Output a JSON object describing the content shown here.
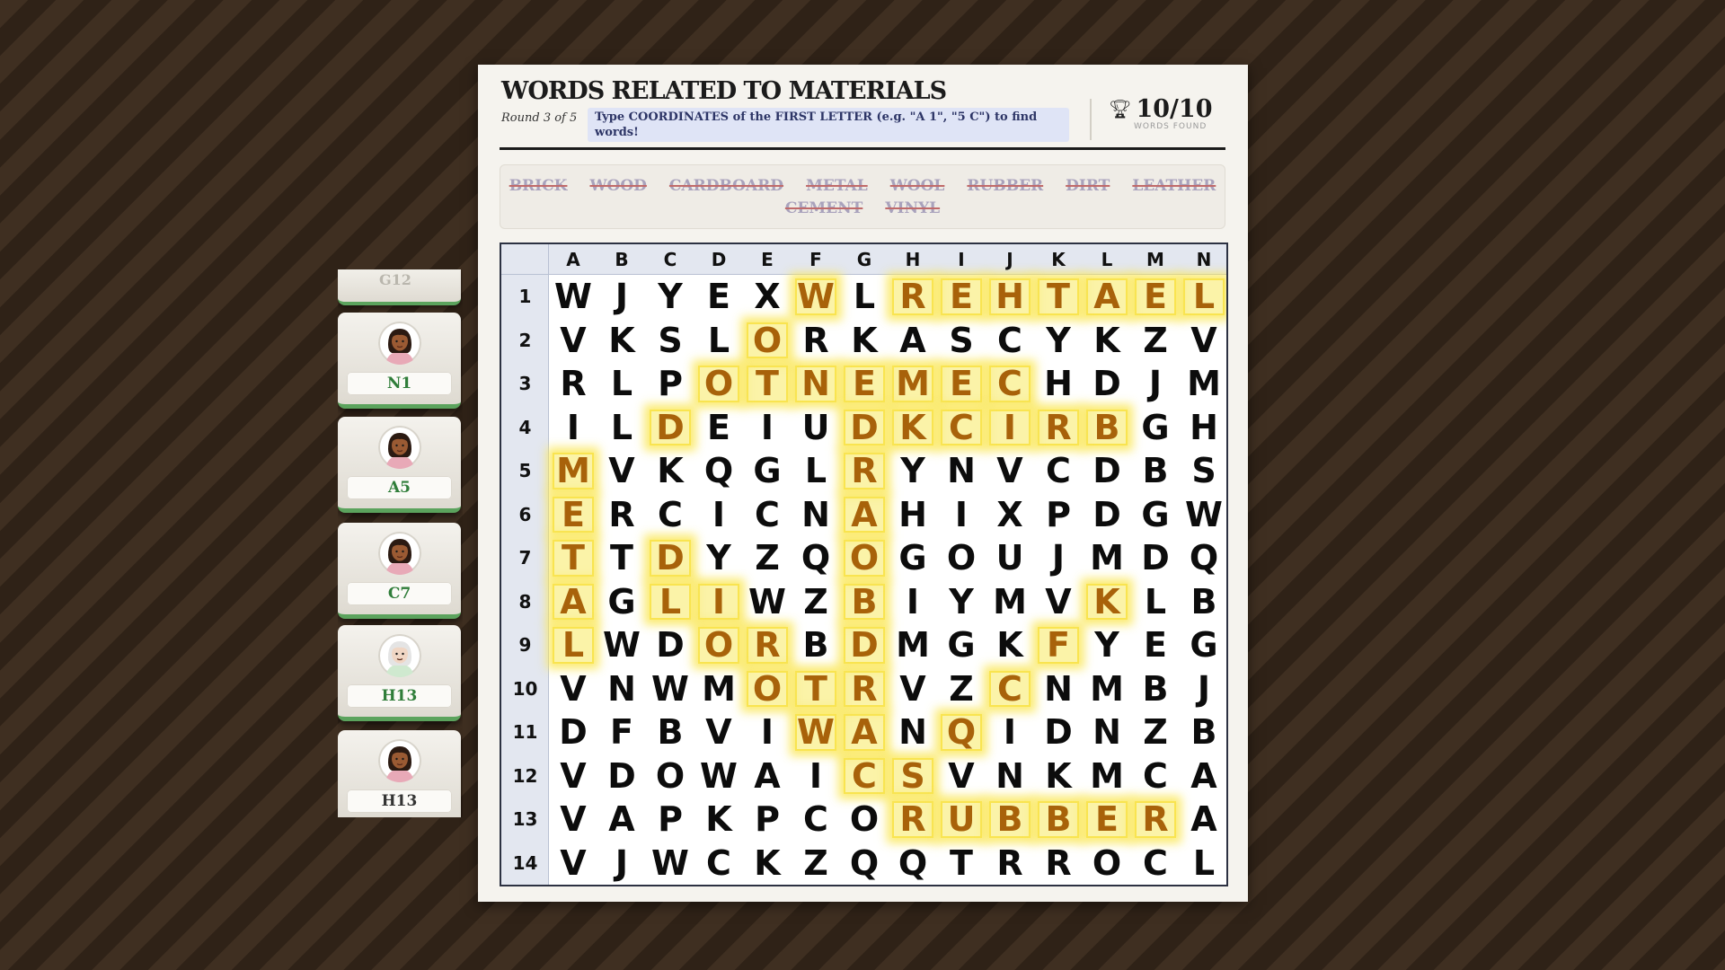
{
  "title": "WORDS RELATED TO MATERIALS",
  "round_text": "Round 3 of 5",
  "instructions": "Type COORDINATES of the FIRST LETTER (e.g. \"A 1\", \"5 C\") to find words!",
  "score": {
    "trophy_icon": "trophy-icon",
    "value": "10/10",
    "label": "WORDS FOUND"
  },
  "word_bank": [
    "BRICK",
    "WOOD",
    "CARDBOARD",
    "METAL",
    "WOOL",
    "RUBBER",
    "DIRT",
    "LEATHER",
    "CEMENT",
    "VINYL"
  ],
  "players": [
    {
      "guess": "G12",
      "avatar": "woman-avatar-icon",
      "found": true,
      "partial": true
    },
    {
      "guess": "N1",
      "avatar": "woman-avatar-icon",
      "found": true
    },
    {
      "guess": "A5",
      "avatar": "woman-avatar-icon",
      "found": true
    },
    {
      "guess": "C7",
      "avatar": "woman-avatar-icon",
      "found": true
    },
    {
      "guess": "H13",
      "avatar": "elderly-woman-avatar-icon",
      "found": true
    },
    {
      "guess": "H13",
      "avatar": "woman-avatar-icon",
      "found": false
    }
  ],
  "grid": {
    "columns": [
      "A",
      "B",
      "C",
      "D",
      "E",
      "F",
      "G",
      "H",
      "I",
      "J",
      "K",
      "L",
      "M",
      "N"
    ],
    "rows": [
      "1",
      "2",
      "3",
      "4",
      "5",
      "6",
      "7",
      "8",
      "9",
      "10",
      "11",
      "12",
      "13",
      "14"
    ],
    "letters": [
      "WJYEXWLREHTAEL",
      "VKSLORKASCYKZV",
      "RLPOTNEMECHDJM",
      "ILDEIUDKCIRBGH",
      "MVKQGLRYNVCDBS",
      "ERCICNAHIXPDGW",
      "TTDYZQOGOUJMDQ",
      "AGLIWZBIYMVKLB",
      "LWDORBDMGKFYEG",
      "VNWMOTRVZCNMBJ",
      "DFBVIWANQIDNZB",
      "VDOWAICSVNKMCA",
      "VAPKPCORUBBERA",
      "VJWCKZQQTRROCL"
    ],
    "found_words": [
      {
        "word": "LEATHER",
        "start": "N1",
        "end": "H1"
      },
      {
        "word": "CEMENT",
        "start": "J3",
        "end": "E3"
      },
      {
        "word": "BRICK",
        "start": "L4",
        "end": "H4"
      },
      {
        "word": "METAL",
        "start": "A5",
        "end": "A9"
      },
      {
        "word": "CARDBOARD",
        "start": "G12",
        "end": "G4"
      },
      {
        "word": "WOOD",
        "start": "F1",
        "end": "C4"
      },
      {
        "word": "DIRT",
        "start": "C7",
        "end": "F10"
      },
      {
        "word": "WOOL",
        "start": "F11",
        "end": "C8"
      },
      {
        "word": "VINYL",
        "start": "H12",
        "end": "L8"
      },
      {
        "word": "RUBBER",
        "start": "H13",
        "end": "M13"
      }
    ],
    "highlight_color": "#fbf3a8",
    "found_letter_color": "#a8620a"
  }
}
